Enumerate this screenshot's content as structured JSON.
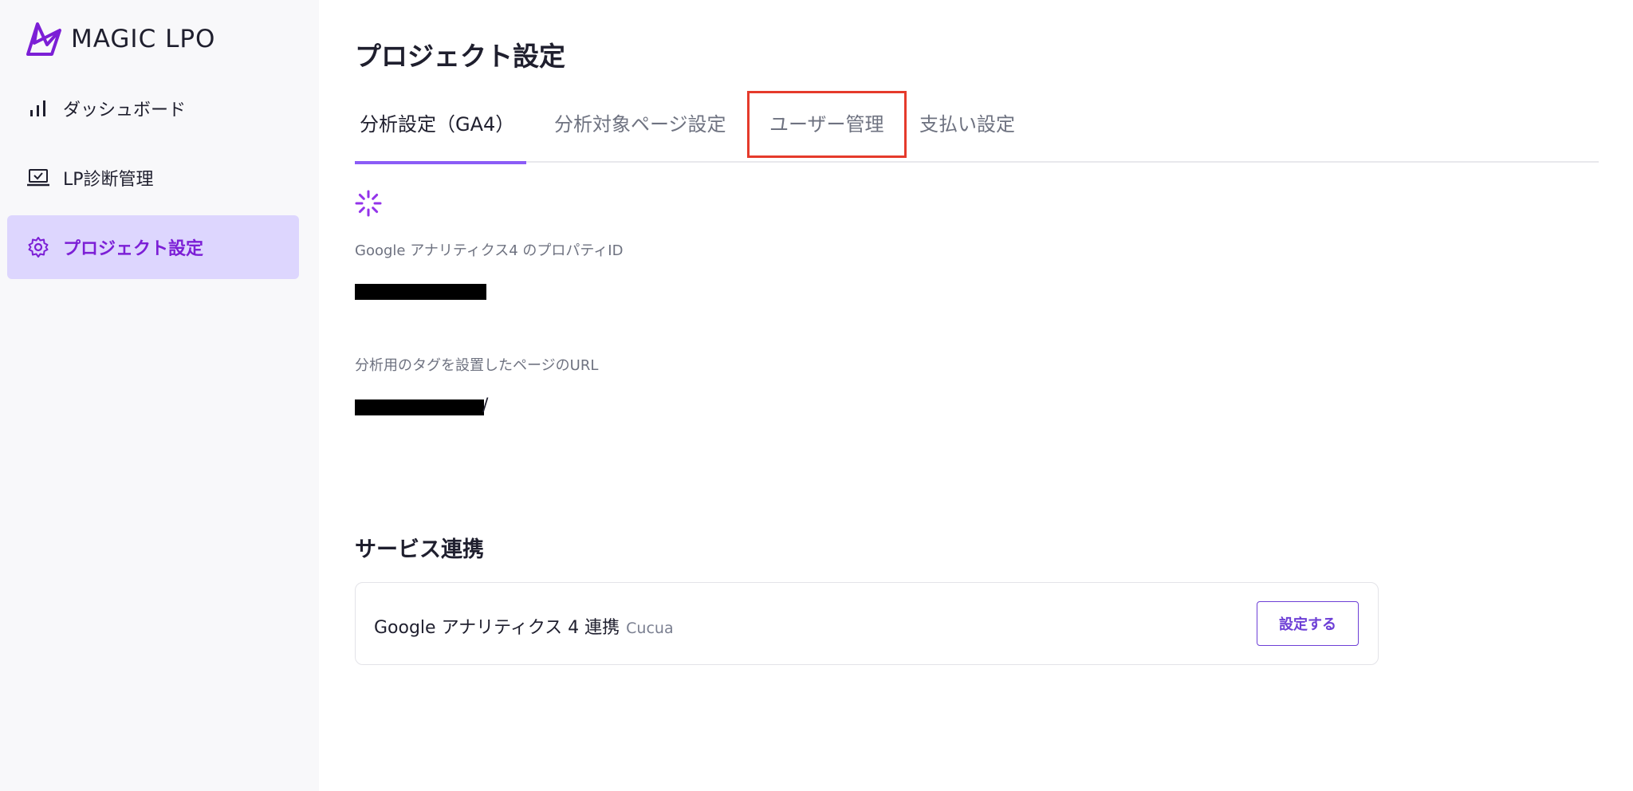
{
  "app": {
    "logo_text": "MAGIC LPO",
    "brand_color": "#7c1fd6",
    "accent_color": "#8b5cf6"
  },
  "sidebar": {
    "items": [
      {
        "label": "ダッシュボード",
        "icon": "bar-chart-icon",
        "active": false
      },
      {
        "label": "LP診断管理",
        "icon": "laptop-check-icon",
        "active": false
      },
      {
        "label": "プロジェクト設定",
        "icon": "gear-icon",
        "active": true
      }
    ]
  },
  "main": {
    "title": "プロジェクト設定",
    "tabs": [
      {
        "label": "分析設定（GA4）",
        "active": true
      },
      {
        "label": "分析対象ページ設定",
        "active": false
      },
      {
        "label": "ユーザー管理",
        "active": false,
        "highlighted": true
      },
      {
        "label": "支払い設定",
        "active": false
      }
    ],
    "highlight_color": "#e53a2b",
    "fields": [
      {
        "label": "Google アナリティクス4 のプロパティID",
        "value_redacted": true
      },
      {
        "label": "分析用のタグを設置したページのURL",
        "value_redacted": true,
        "value_suffix": "/"
      }
    ],
    "services_section": {
      "title": "サービス連携",
      "items": [
        {
          "name": "Google アナリティクス 4 連携",
          "account": "Cucua",
          "button_label": "設定する"
        }
      ]
    }
  }
}
